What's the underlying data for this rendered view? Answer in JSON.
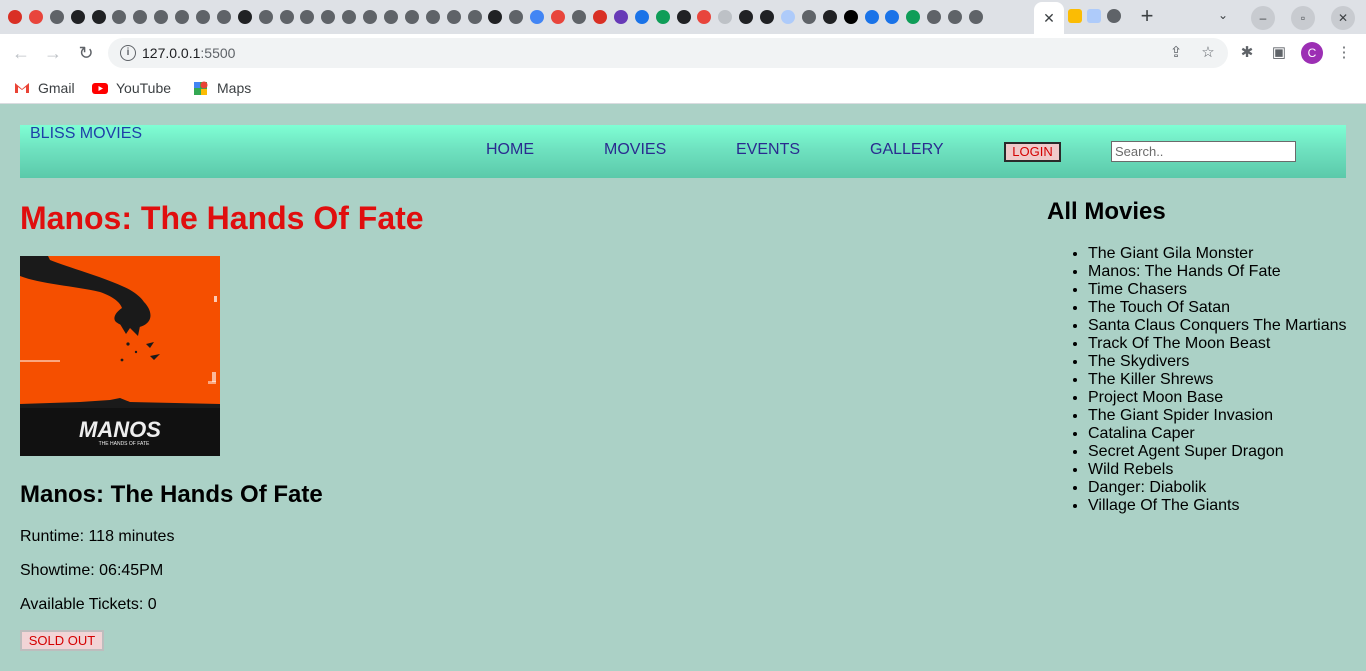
{
  "browser": {
    "url_host": "127.0.0.1",
    "url_port": ":5500",
    "profile_initial": "C",
    "bookmarks": [
      {
        "label": "Gmail",
        "icon": "gmail-icon"
      },
      {
        "label": "YouTube",
        "icon": "youtube-icon"
      },
      {
        "label": "Maps",
        "icon": "maps-icon"
      }
    ],
    "tab_icon_colors": [
      "#d93025",
      "#e8453c",
      "#5f6368",
      "#202124",
      "#202124",
      "#5f6368",
      "#5f6368",
      "#5f6368",
      "#5f6368",
      "#5f6368",
      "#5f6368",
      "#202124",
      "#5f6368",
      "#5f6368",
      "#5f6368",
      "#5f6368",
      "#5f6368",
      "#5f6368",
      "#5f6368",
      "#5f6368",
      "#5f6368",
      "#5f6368",
      "#5f6368",
      "#202124",
      "#5f6368",
      "#4285f4",
      "#e8453c",
      "#5f6368",
      "#d93025",
      "#673ab7",
      "#1a73e8",
      "#0f9d58",
      "#202124",
      "#e8453c",
      "#bdc1c6",
      "#202124",
      "#202124",
      "#aecbfa",
      "#5f6368",
      "#202124",
      "#000000",
      "#1a73e8",
      "#1a73e8",
      "#0f9d58",
      "#5f6368",
      "#5f6368",
      "#5f6368"
    ]
  },
  "site": {
    "brand": "BLISS MOVIES",
    "nav": [
      "HOME",
      "MOVIES",
      "EVENTS",
      "GALLERY"
    ],
    "login_label": "LOGIN",
    "search_placeholder": "Search.."
  },
  "movie": {
    "title": "Manos: The Hands Of Fate",
    "runtime": "Runtime: 118 minutes",
    "showtime": "Showtime: 06:45PM",
    "tickets": "Available Tickets: 0",
    "button_label": "SOLD OUT",
    "poster_text": "MANOS",
    "poster_subtext": "THE HANDS OF FATE",
    "poster_colors": {
      "background": "#f54f00",
      "band": "#111111",
      "ink": "#1a1a1a"
    }
  },
  "sidebar": {
    "title": "All Movies",
    "movies": [
      "The Giant Gila Monster",
      "Manos: The Hands Of Fate",
      "Time Chasers",
      "The Touch Of Satan",
      "Santa Claus Conquers The Martians",
      "Track Of The Moon Beast",
      "The Skydivers",
      "The Killer Shrews",
      "Project Moon Base",
      "The Giant Spider Invasion",
      "Catalina Caper",
      "Secret Agent Super Dragon",
      "Wild Rebels",
      "Danger: Diabolik",
      "Village Of The Giants"
    ]
  },
  "colors": {
    "page_bg": "#abd1c6",
    "nav_gradient_top": "#7fffd4",
    "title_red": "#e00e0e",
    "nav_link": "#2a2b8f"
  }
}
